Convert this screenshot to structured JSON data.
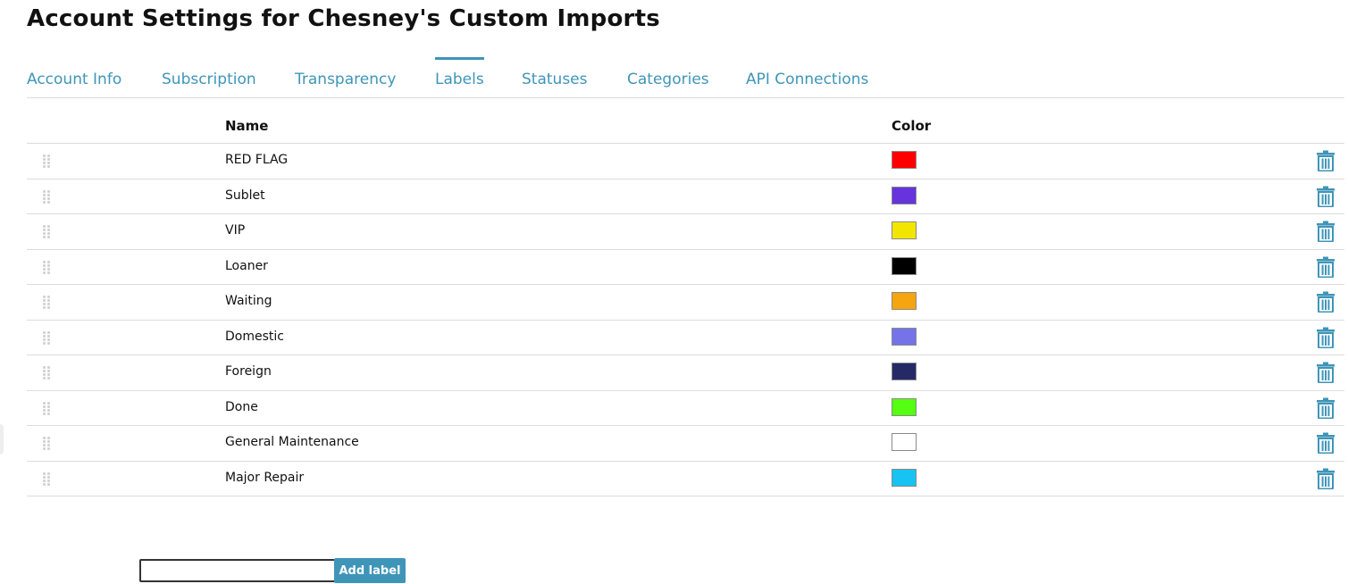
{
  "page": {
    "title": "Account Settings for Chesney's Custom Imports"
  },
  "tabs": [
    {
      "label": "Account Info",
      "active": false
    },
    {
      "label": "Subscription",
      "active": false
    },
    {
      "label": "Transparency",
      "active": false
    },
    {
      "label": "Labels",
      "active": true
    },
    {
      "label": "Statuses",
      "active": false
    },
    {
      "label": "Categories",
      "active": false
    },
    {
      "label": "API Connections",
      "active": false
    }
  ],
  "table": {
    "columns": {
      "name": "Name",
      "color": "Color"
    },
    "rows": [
      {
        "name": "RED FLAG",
        "color": "#ff0000"
      },
      {
        "name": "Sublet",
        "color": "#6633dd"
      },
      {
        "name": "VIP",
        "color": "#f2e600"
      },
      {
        "name": "Loaner",
        "color": "#000000"
      },
      {
        "name": "Waiting",
        "color": "#f5a510"
      },
      {
        "name": "Domestic",
        "color": "#7474e8"
      },
      {
        "name": "Foreign",
        "color": "#252a66"
      },
      {
        "name": "Done",
        "color": "#55ff11"
      },
      {
        "name": "General Maintenance",
        "color": "#ffffff"
      },
      {
        "name": "Major Repair",
        "color": "#16c3f3"
      }
    ]
  },
  "add_label": {
    "input_value": "",
    "input_placeholder": "",
    "button_label": "Add label"
  },
  "theme": {
    "accent": "#3f95b8",
    "icon": "trash-icon",
    "drag_icon": "drag-handle-icon"
  }
}
